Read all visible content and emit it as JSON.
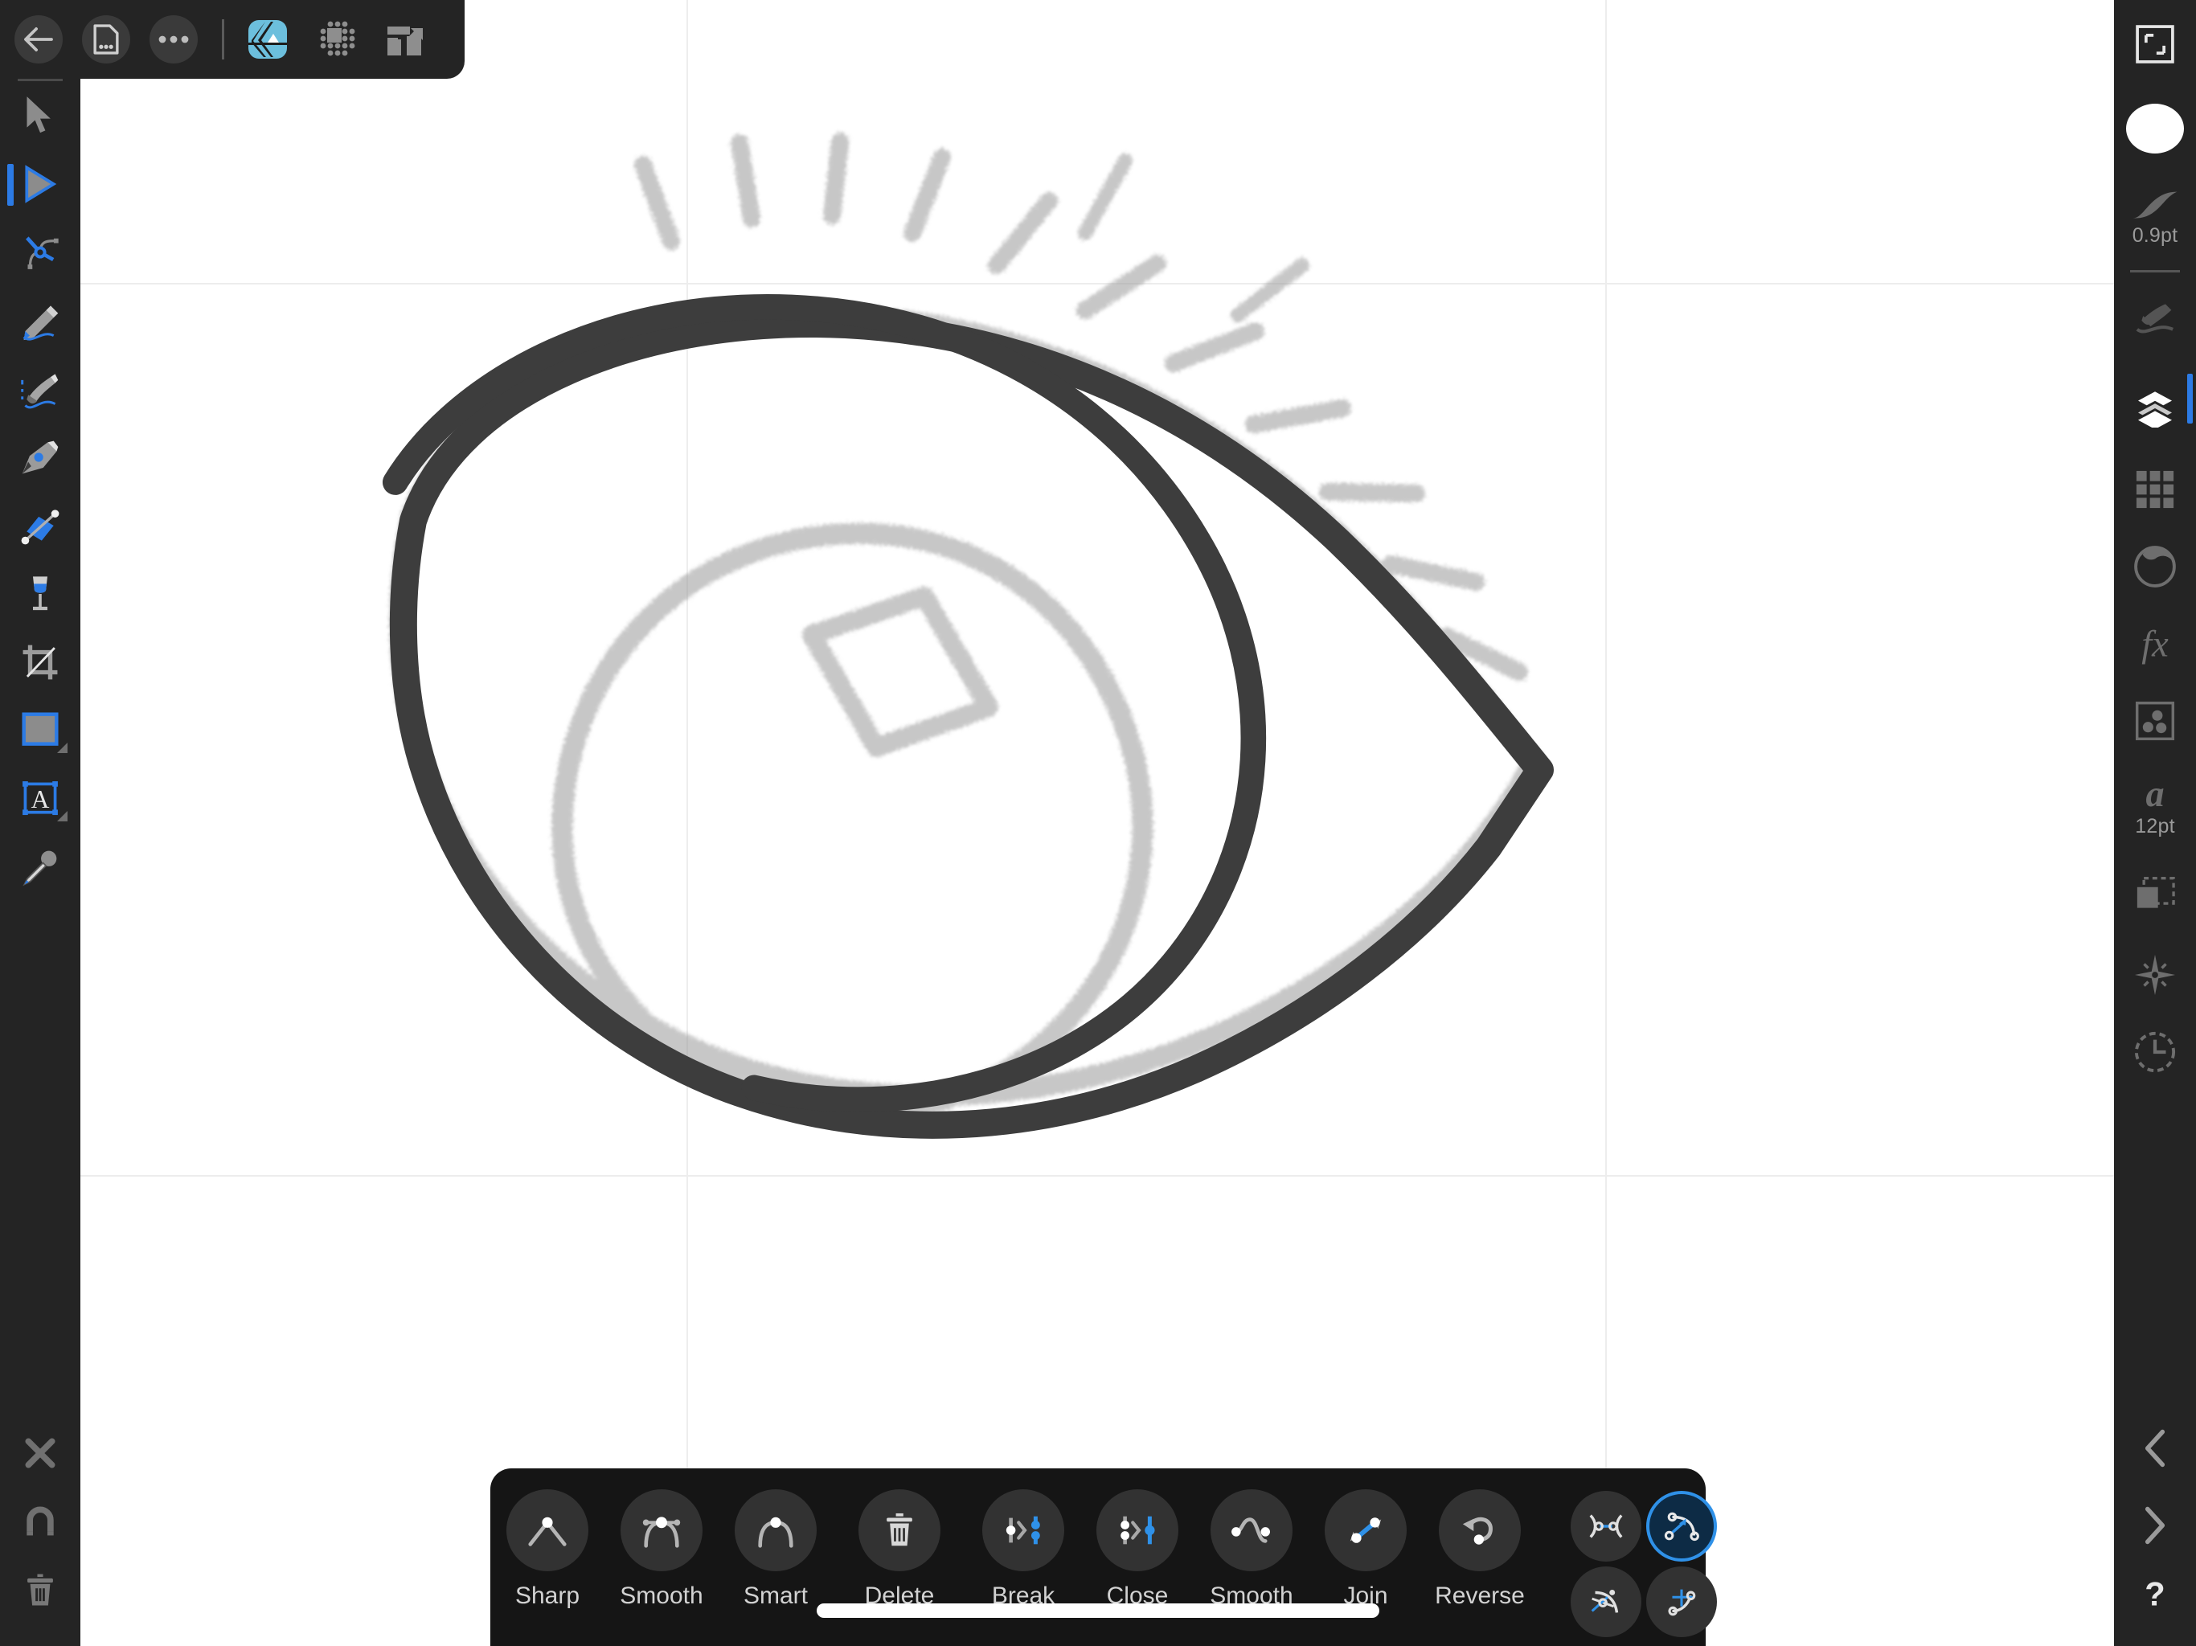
{
  "app": {
    "name": "Affinity Designer",
    "document_title": ""
  },
  "top_toolbar": {
    "items": [
      {
        "name": "back-button",
        "icon": "back-arrow-icon",
        "label": "Back"
      },
      {
        "name": "document-menu-button",
        "icon": "document-icon",
        "label": "Document"
      },
      {
        "name": "more-options-button",
        "icon": "ellipsis-icon",
        "label": "More"
      },
      {
        "name": "persona-designer-button",
        "icon": "affinity-designer-persona-icon",
        "label": "Designer Persona"
      },
      {
        "name": "persona-pixel-button",
        "icon": "pixel-persona-icon",
        "label": "Pixel Persona"
      },
      {
        "name": "persona-export-button",
        "icon": "export-persona-icon",
        "label": "Export Persona"
      }
    ],
    "accent_color": "#6cbfdd"
  },
  "left_toolbar": {
    "selected_index": 1,
    "tools": [
      {
        "name": "move-tool",
        "icon": "arrow-cursor-icon",
        "label": "Move Tool"
      },
      {
        "name": "node-tool",
        "icon": "node-cursor-icon",
        "label": "Node Tool"
      },
      {
        "name": "corner-tool",
        "icon": "corner-node-icon",
        "label": "Corner Tool"
      },
      {
        "name": "pencil-tool",
        "icon": "pencil-icon",
        "label": "Pencil Tool"
      },
      {
        "name": "vector-brush-tool",
        "icon": "paintbrush-icon",
        "label": "Vector Brush Tool"
      },
      {
        "name": "pen-tool",
        "icon": "pen-nib-icon",
        "label": "Pen Tool"
      },
      {
        "name": "shape-builder-tool",
        "icon": "shape-builder-icon",
        "label": "Shape Builder Tool"
      },
      {
        "name": "fill-tool",
        "icon": "gradient-goblet-icon",
        "label": "Fill Tool"
      },
      {
        "name": "crop-tool",
        "icon": "crop-icon",
        "label": "Crop Tool"
      },
      {
        "name": "rectangle-tool",
        "icon": "rectangle-shape-icon",
        "label": "Rectangle Tool",
        "has_submenu": true
      },
      {
        "name": "text-tool",
        "icon": "artistic-text-icon",
        "label": "Artistic Text Tool",
        "has_submenu": true
      },
      {
        "name": "colour-picker-tool",
        "icon": "eyedropper-icon",
        "label": "Colour Picker Tool"
      }
    ],
    "bottom_tools": [
      {
        "name": "deselect-button",
        "icon": "close-x-icon",
        "label": "Deselect"
      },
      {
        "name": "snapping-button",
        "icon": "magnet-icon",
        "label": "Snapping"
      },
      {
        "name": "delete-button",
        "icon": "trash-icon",
        "label": "Delete"
      }
    ],
    "selection_color": "#2c7be5"
  },
  "right_sidebar": {
    "selected_index": 4,
    "stroke_width": "0.9pt",
    "font_size": "12pt",
    "items": [
      {
        "name": "document-setup-button",
        "icon": "artboard-frame-icon",
        "label": "Document"
      },
      {
        "name": "fill-colour-swatch",
        "icon": "colour-swatch-icon",
        "label": "Colour",
        "colour": "#ffffff"
      },
      {
        "name": "stroke-width-button",
        "icon": "stroke-swoosh-icon",
        "label": "Stroke",
        "value": "0.9pt"
      },
      {
        "name": "brush-studio-button",
        "icon": "brush-icon",
        "label": "Brushes"
      },
      {
        "name": "layers-studio-button",
        "icon": "layers-stack-icon",
        "label": "Layers"
      },
      {
        "name": "swatches-studio-button",
        "icon": "swatch-grid-icon",
        "label": "Swatches"
      },
      {
        "name": "adjustments-studio-button",
        "icon": "adjustment-circle-icon",
        "label": "Adjustments"
      },
      {
        "name": "effects-studio-button",
        "icon": "fx-icon",
        "label": "Effects"
      },
      {
        "name": "assets-studio-button",
        "icon": "assets-box-icon",
        "label": "Assets"
      },
      {
        "name": "character-studio-button",
        "icon": "character-a-icon",
        "label": "Character",
        "value": "12pt"
      },
      {
        "name": "transform-studio-button",
        "icon": "transform-icon",
        "label": "Transform"
      },
      {
        "name": "navigator-studio-button",
        "icon": "compass-icon",
        "label": "Navigator"
      },
      {
        "name": "history-studio-button",
        "icon": "history-clock-icon",
        "label": "History"
      }
    ],
    "bottom_items": [
      {
        "name": "undo-button",
        "icon": "chevron-left-icon",
        "label": "Undo"
      },
      {
        "name": "redo-button",
        "icon": "chevron-right-icon",
        "label": "Redo"
      },
      {
        "name": "help-button",
        "icon": "question-mark-icon",
        "label": "Help"
      }
    ],
    "selection_color": "#2c7be5"
  },
  "context_toolbar": {
    "groups": [
      {
        "name": "node-type-group",
        "items": [
          {
            "name": "sharp-node-button",
            "icon": "sharp-node-icon",
            "label": "Sharp"
          },
          {
            "name": "smooth-node-button",
            "icon": "smooth-node-icon",
            "label": "Smooth"
          },
          {
            "name": "smart-node-button",
            "icon": "smart-node-icon",
            "label": "Smart"
          }
        ]
      },
      {
        "name": "node-action-group",
        "items": [
          {
            "name": "delete-node-button",
            "icon": "trash-icon",
            "label": "Delete"
          }
        ]
      },
      {
        "name": "curve-action-group",
        "items": [
          {
            "name": "break-curve-button",
            "icon": "break-curve-icon",
            "label": "Break"
          },
          {
            "name": "close-curve-button",
            "icon": "close-curve-icon",
            "label": "Close"
          },
          {
            "name": "smooth-curve-button",
            "icon": "smooth-curve-icon",
            "label": "Smooth"
          },
          {
            "name": "join-curve-button",
            "icon": "join-curve-icon",
            "label": "Join"
          },
          {
            "name": "reverse-curve-button",
            "icon": "reverse-curve-icon",
            "label": "Reverse"
          }
        ]
      }
    ],
    "mode_buttons": [
      {
        "name": "mode-convert-line-button",
        "icon": "convert-to-line-icon",
        "active": false
      },
      {
        "name": "mode-convert-curve-button",
        "icon": "convert-to-curve-icon",
        "active": true
      },
      {
        "name": "mode-transform-handles-button",
        "icon": "transform-handles-icon",
        "active": false
      },
      {
        "name": "mode-align-nodes-button",
        "icon": "align-nodes-icon",
        "active": false
      }
    ],
    "active_color": "#2f91e8"
  },
  "canvas": {
    "background": "#ffffff",
    "guides": {
      "color": "#ededed",
      "vertical_x": [
        854,
        1997
      ],
      "horizontal_y": [
        352,
        1462
      ]
    },
    "artwork_description": "Hand-drawn eye illustration — dark vector outline over a light grey raster sketch with eyelashes"
  }
}
